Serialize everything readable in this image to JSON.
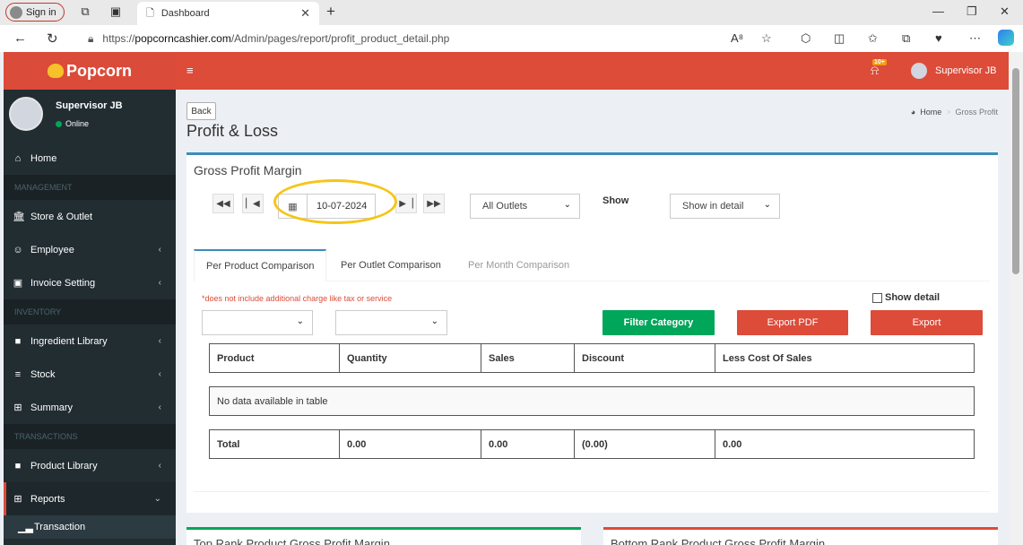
{
  "browser": {
    "signin_label": "Sign in",
    "tab_title": "Dashboard",
    "url_prefix": "https://",
    "url_domain": "popcorncashier.com",
    "url_path": "/Admin/pages/report/profit_product_detail.php"
  },
  "sidebar": {
    "brand": "Popcorn",
    "user_name": "Supervisor JB",
    "user_status": "Online",
    "items": [
      {
        "label": "Home",
        "icon": "home-icon"
      },
      {
        "header": "MANAGEMENT"
      },
      {
        "label": "Store & Outlet",
        "icon": "bank-icon"
      },
      {
        "label": "Employee",
        "icon": "users-icon"
      },
      {
        "label": "Invoice Setting",
        "icon": "money-icon"
      },
      {
        "header": "INVENTORY"
      },
      {
        "label": "Ingredient Library",
        "icon": "book-icon"
      },
      {
        "label": "Stock",
        "icon": "database-icon"
      },
      {
        "label": "Summary",
        "icon": "table-icon"
      },
      {
        "header": "TRANSACTIONS"
      },
      {
        "label": "Product Library",
        "icon": "book-icon"
      },
      {
        "label": "Reports",
        "icon": "table-icon"
      },
      {
        "label": "Transaction",
        "icon": "chart-icon"
      }
    ]
  },
  "header": {
    "badge": "10+",
    "user_name": "Supervisor JB"
  },
  "page": {
    "back_label": "Back",
    "title": "Profit & Loss",
    "breadcrumb_home": "Home",
    "breadcrumb_current": "Gross Profit"
  },
  "report": {
    "box_title": "Gross Profit Margin",
    "date": "10-07-2024",
    "outlet_select": "All Outlets",
    "show_label": "Show",
    "show_select": "Show in detail",
    "tabs": [
      "Per Product Comparison",
      "Per Outlet Comparison",
      "Per Month Comparison"
    ],
    "note": "*does not include additional charge like tax or service",
    "show_detail_label": "Show detail",
    "filter_btn": "Filter Category",
    "export_pdf_btn": "Export PDF",
    "export_btn": "Export",
    "columns": [
      "Product",
      "Quantity",
      "Sales",
      "Discount",
      "Less Cost Of Sales"
    ],
    "empty_text": "No data available in table",
    "total": [
      "Total",
      "0.00",
      "0.00",
      "(0.00)",
      "0.00"
    ]
  },
  "lower": {
    "left_title": "Top Rank Product Gross Profit Margin",
    "right_title": "Bottom Rank Product Gross Profit Margin"
  }
}
